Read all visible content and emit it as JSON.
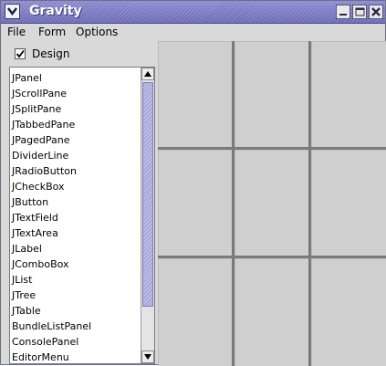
{
  "window": {
    "title": "Gravity",
    "colors": {
      "titlebar": "#7676c2",
      "scroll_thumb": "#a8a8dc",
      "panel": "#d9d9d9",
      "cell": "#cfcfcf"
    }
  },
  "menu": {
    "items": [
      "File",
      "Form",
      "Options"
    ]
  },
  "design_toggle": {
    "label": "Design",
    "checked": true
  },
  "components": {
    "items": [
      "JPanel",
      "JScrollPane",
      "JSplitPane",
      "JTabbedPane",
      "JPagedPane",
      "DividerLine",
      "JRadioButton",
      "JCheckBox",
      "JButton",
      "JTextField",
      "JTextArea",
      "JLabel",
      "JComboBox",
      "JList",
      "JTree",
      "JTable",
      "BundleListPanel",
      "ConsolePanel",
      "EditorMenu"
    ]
  },
  "grid": {
    "rows": 3,
    "columns": 3
  }
}
